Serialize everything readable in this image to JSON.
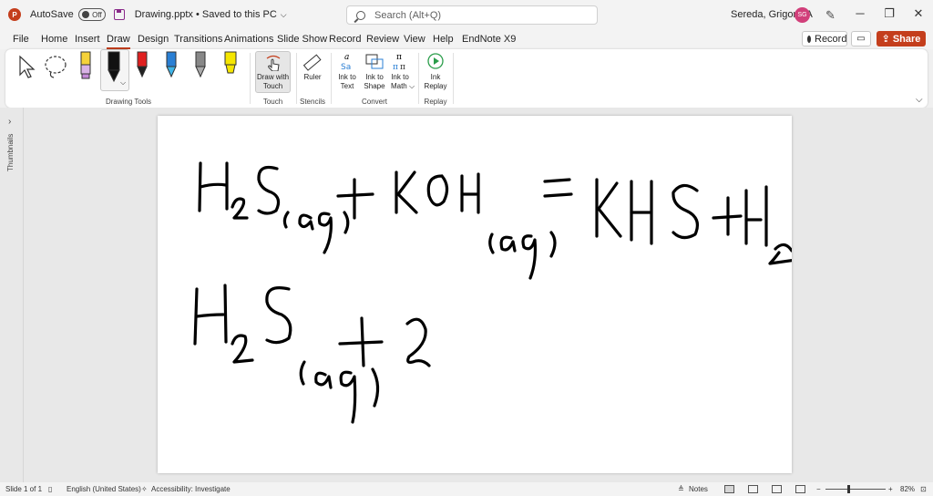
{
  "titlebar": {
    "autosave_label": "AutoSave",
    "autosave_state": "Off",
    "document": "Drawing.pptx • Saved to this PC",
    "search_placeholder": "Search (Alt+Q)",
    "user": "Sereda, Grigoriy A",
    "initials": "SG"
  },
  "tabs": [
    "File",
    "Home",
    "Insert",
    "Draw",
    "Design",
    "Transitions",
    "Animations",
    "Slide Show",
    "Record",
    "Review",
    "View",
    "Help",
    "EndNote X9"
  ],
  "active_tab": "Draw",
  "actions": {
    "record": "Record",
    "share": "Share"
  },
  "ribbon": {
    "groups": {
      "drawing_tools": "Drawing Tools",
      "touch": "Touch",
      "stencils": "Stencils",
      "convert": "Convert",
      "replay": "Replay"
    },
    "buttons": {
      "draw_with_touch_1": "Draw with",
      "draw_with_touch_2": "Touch",
      "ruler": "Ruler",
      "ink_to_text_1": "Ink to",
      "ink_to_text_2": "Text",
      "ink_to_shape_1": "Ink to",
      "ink_to_shape_2": "Shape",
      "ink_to_math_1": "Ink to",
      "ink_to_math_2": "Math",
      "ink_replay_1": "Ink",
      "ink_replay_2": "Replay"
    },
    "pen_colors": [
      "#000000",
      "#e02020",
      "#2a7fd4",
      "#888888",
      "#f5e600"
    ]
  },
  "sidebar": {
    "thumbnails_label": "Thumbnails"
  },
  "status": {
    "slide": "Slide 1 of 1",
    "language": "English (United States)",
    "accessibility": "Accessibility: Investigate",
    "notes": "Notes",
    "zoom": "82%"
  }
}
